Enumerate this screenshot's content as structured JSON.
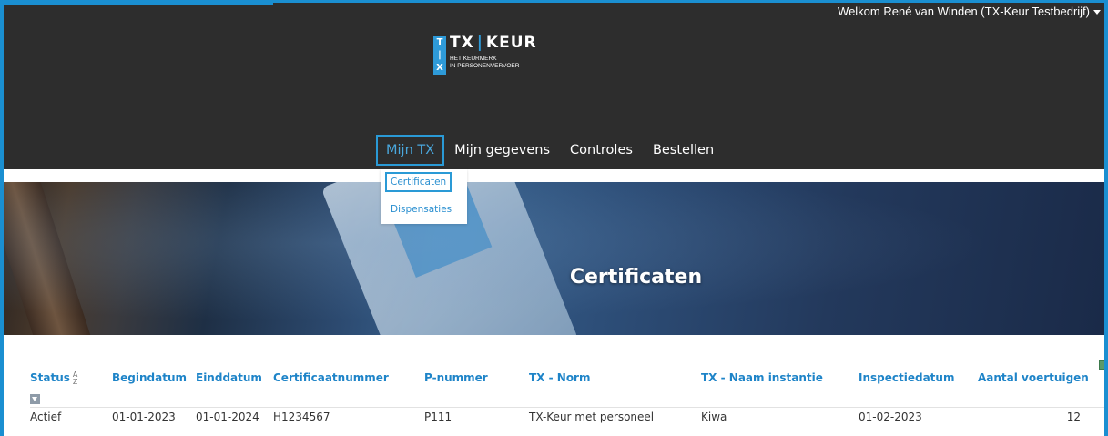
{
  "header": {
    "welcome_text": "Welkom René van Winden (TX-Keur Testbedrijf)",
    "logo": {
      "title_left": "TX",
      "title_right": "KEUR",
      "tile_letters": "T X",
      "subtitle_line1": "HET KEURMERK",
      "subtitle_line2": "IN PERSONENVERVOER"
    }
  },
  "nav": {
    "items": [
      {
        "label": "Mijn TX"
      },
      {
        "label": "Mijn gegevens"
      },
      {
        "label": "Controles"
      },
      {
        "label": "Bestellen"
      }
    ]
  },
  "dropdown": {
    "items": [
      {
        "label": "Certificaten"
      },
      {
        "label": "Dispensaties"
      }
    ]
  },
  "hero": {
    "title": "Certificaten"
  },
  "table": {
    "columns": [
      "Status",
      "Begindatum",
      "Einddatum",
      "Certificaatnummer",
      "P-nummer",
      "TX - Norm",
      "TX - Naam instantie",
      "Inspectiedatum",
      "Aantal voertuigen"
    ],
    "rows": [
      [
        "Actief",
        "01-01-2023",
        "01-01-2024",
        "H1234567",
        "P111",
        "TX-Keur met personeel",
        "Kiwa",
        "01-02-2023",
        "12"
      ]
    ],
    "sort_icon": "sort-alpha-icon"
  },
  "colors": {
    "accent": "#1e84c8",
    "header_bg": "#2d2d2d",
    "frame": "#1a8fd1"
  }
}
